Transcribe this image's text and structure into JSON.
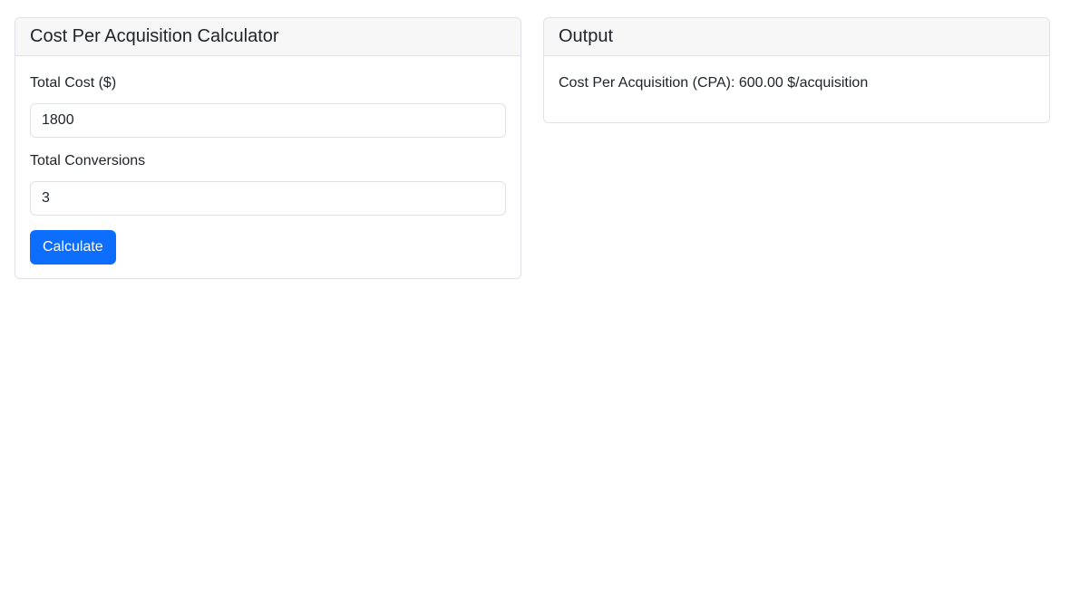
{
  "calculator": {
    "title": "Cost Per Acquisition Calculator",
    "total_cost_label": "Total Cost ($)",
    "total_cost_value": "1800",
    "total_conversions_label": "Total Conversions",
    "total_conversions_value": "3",
    "calculate_label": "Calculate"
  },
  "output": {
    "title": "Output",
    "result_text": "Cost Per Acquisition (CPA): 600.00 $/acquisition"
  },
  "colors": {
    "primary": "#0d6efd",
    "header_bg": "#f7f7f7",
    "border": "#dee2e6",
    "text": "#212529"
  }
}
